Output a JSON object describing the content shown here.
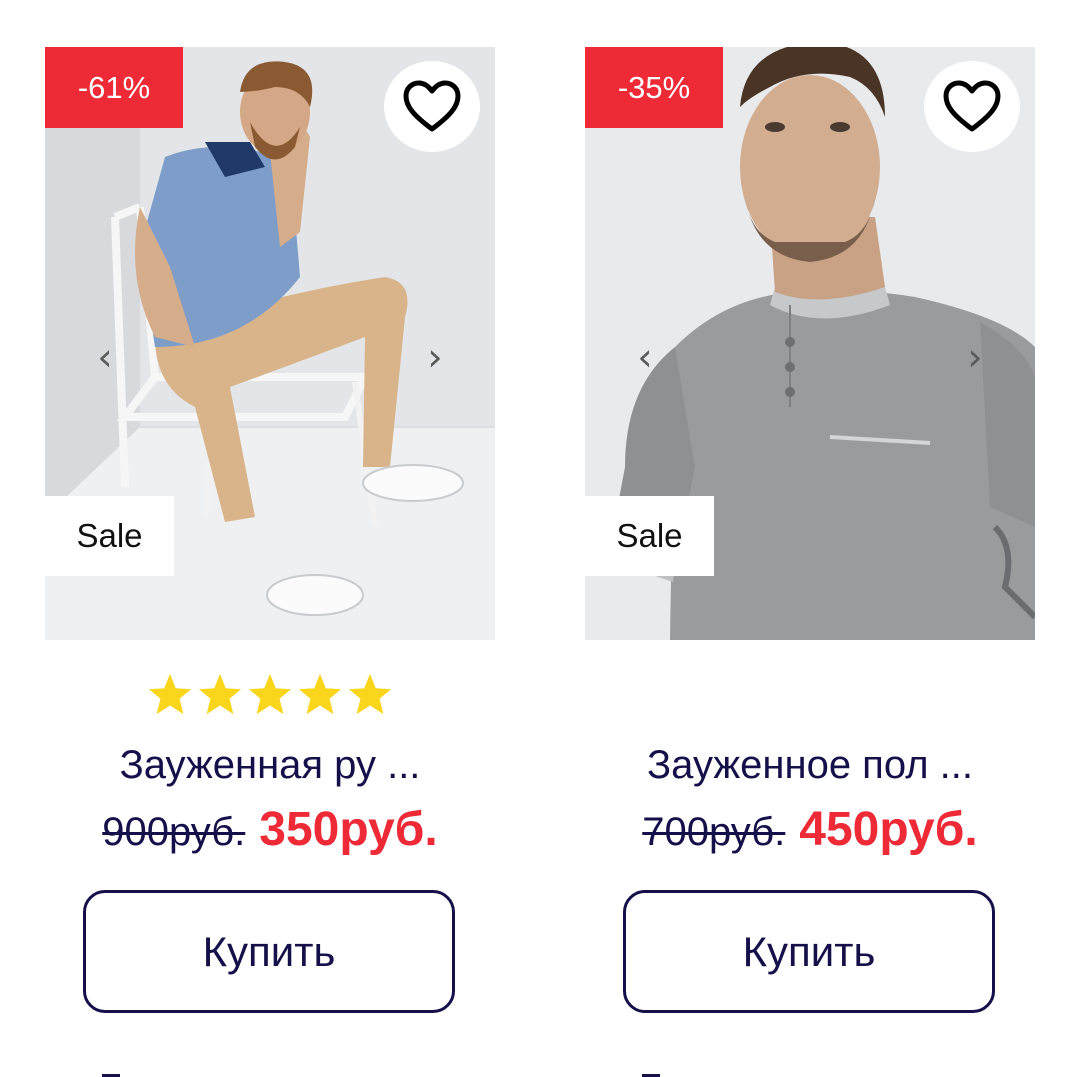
{
  "products": [
    {
      "discount": "-61%",
      "sale_label": "Sale",
      "rating": 5,
      "name": "Зауженная ру ...",
      "old_price": "900руб.",
      "new_price": "350руб.",
      "buy_label": "Купить",
      "prev_arrow": "‹",
      "next_arrow": "›"
    },
    {
      "discount": "-35%",
      "sale_label": "Sale",
      "name": "Зауженное пол ...",
      "old_price": "700руб.",
      "new_price": "450руб.",
      "buy_label": "Купить",
      "prev_arrow": "‹",
      "next_arrow": "›"
    }
  ],
  "colors": {
    "accent_red": "#ee2a37",
    "text_navy": "#15104a",
    "star_yellow": "#f9d51c"
  },
  "icons": {
    "favorite": "heart-outline-icon",
    "rating": "star-icon",
    "prev": "chevron-left-icon",
    "next": "chevron-right-icon"
  }
}
